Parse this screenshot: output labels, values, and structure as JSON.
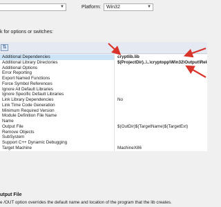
{
  "header": {
    "config_value": "",
    "platform_label": "Platform:",
    "platform_value": "Win32",
    "hint": "k for options or switches:"
  },
  "toolbar": {
    "sort_icon": "⇅"
  },
  "grid": {
    "rows": [
      {
        "name": "Additional Dependencies",
        "value": "cryptlib.lib",
        "bold": true
      },
      {
        "name": "Additional Library Directories",
        "value": "$(ProjectDir)..\\..\\cryptopp\\Win32\\Output\\Rele",
        "bold": true
      },
      {
        "name": "Additional Options",
        "value": "",
        "bold": false
      },
      {
        "name": "Error Reporting",
        "value": "",
        "bold": false
      },
      {
        "name": "Export Named Functions",
        "value": "",
        "bold": false
      },
      {
        "name": "Force Symbol References",
        "value": "",
        "bold": false
      },
      {
        "name": "Ignore All Default Libraries",
        "value": "",
        "bold": false
      },
      {
        "name": "Ignore Specific Default Libraries",
        "value": "",
        "bold": false
      },
      {
        "name": "Link Library Dependencies",
        "value": "No",
        "bold": false
      },
      {
        "name": "Link Time Code Generation",
        "value": "",
        "bold": false
      },
      {
        "name": "Minimum Required Version",
        "value": "",
        "bold": false
      },
      {
        "name": "Module Definition File Name",
        "value": "",
        "bold": false
      },
      {
        "name": "Name",
        "value": "",
        "bold": false
      },
      {
        "name": "Output File",
        "value": "$(OutDir)$(TargetName)$(TargetExt)",
        "bold": false
      },
      {
        "name": "Remove Objects",
        "value": "",
        "bold": false
      },
      {
        "name": "SubSystem",
        "value": "",
        "bold": false
      },
      {
        "name": "Support C++ Dynamic Debugging",
        "value": "",
        "bold": false
      },
      {
        "name": "Target Machine",
        "value": "MachineX86",
        "bold": false
      }
    ]
  },
  "description": {
    "title": "utput File",
    "text": "e /OUT option overrides the default name and location of the program that the lib creates."
  },
  "colors": {
    "annotation_arrow": "#d9342b",
    "selection": "#cce4f7"
  }
}
